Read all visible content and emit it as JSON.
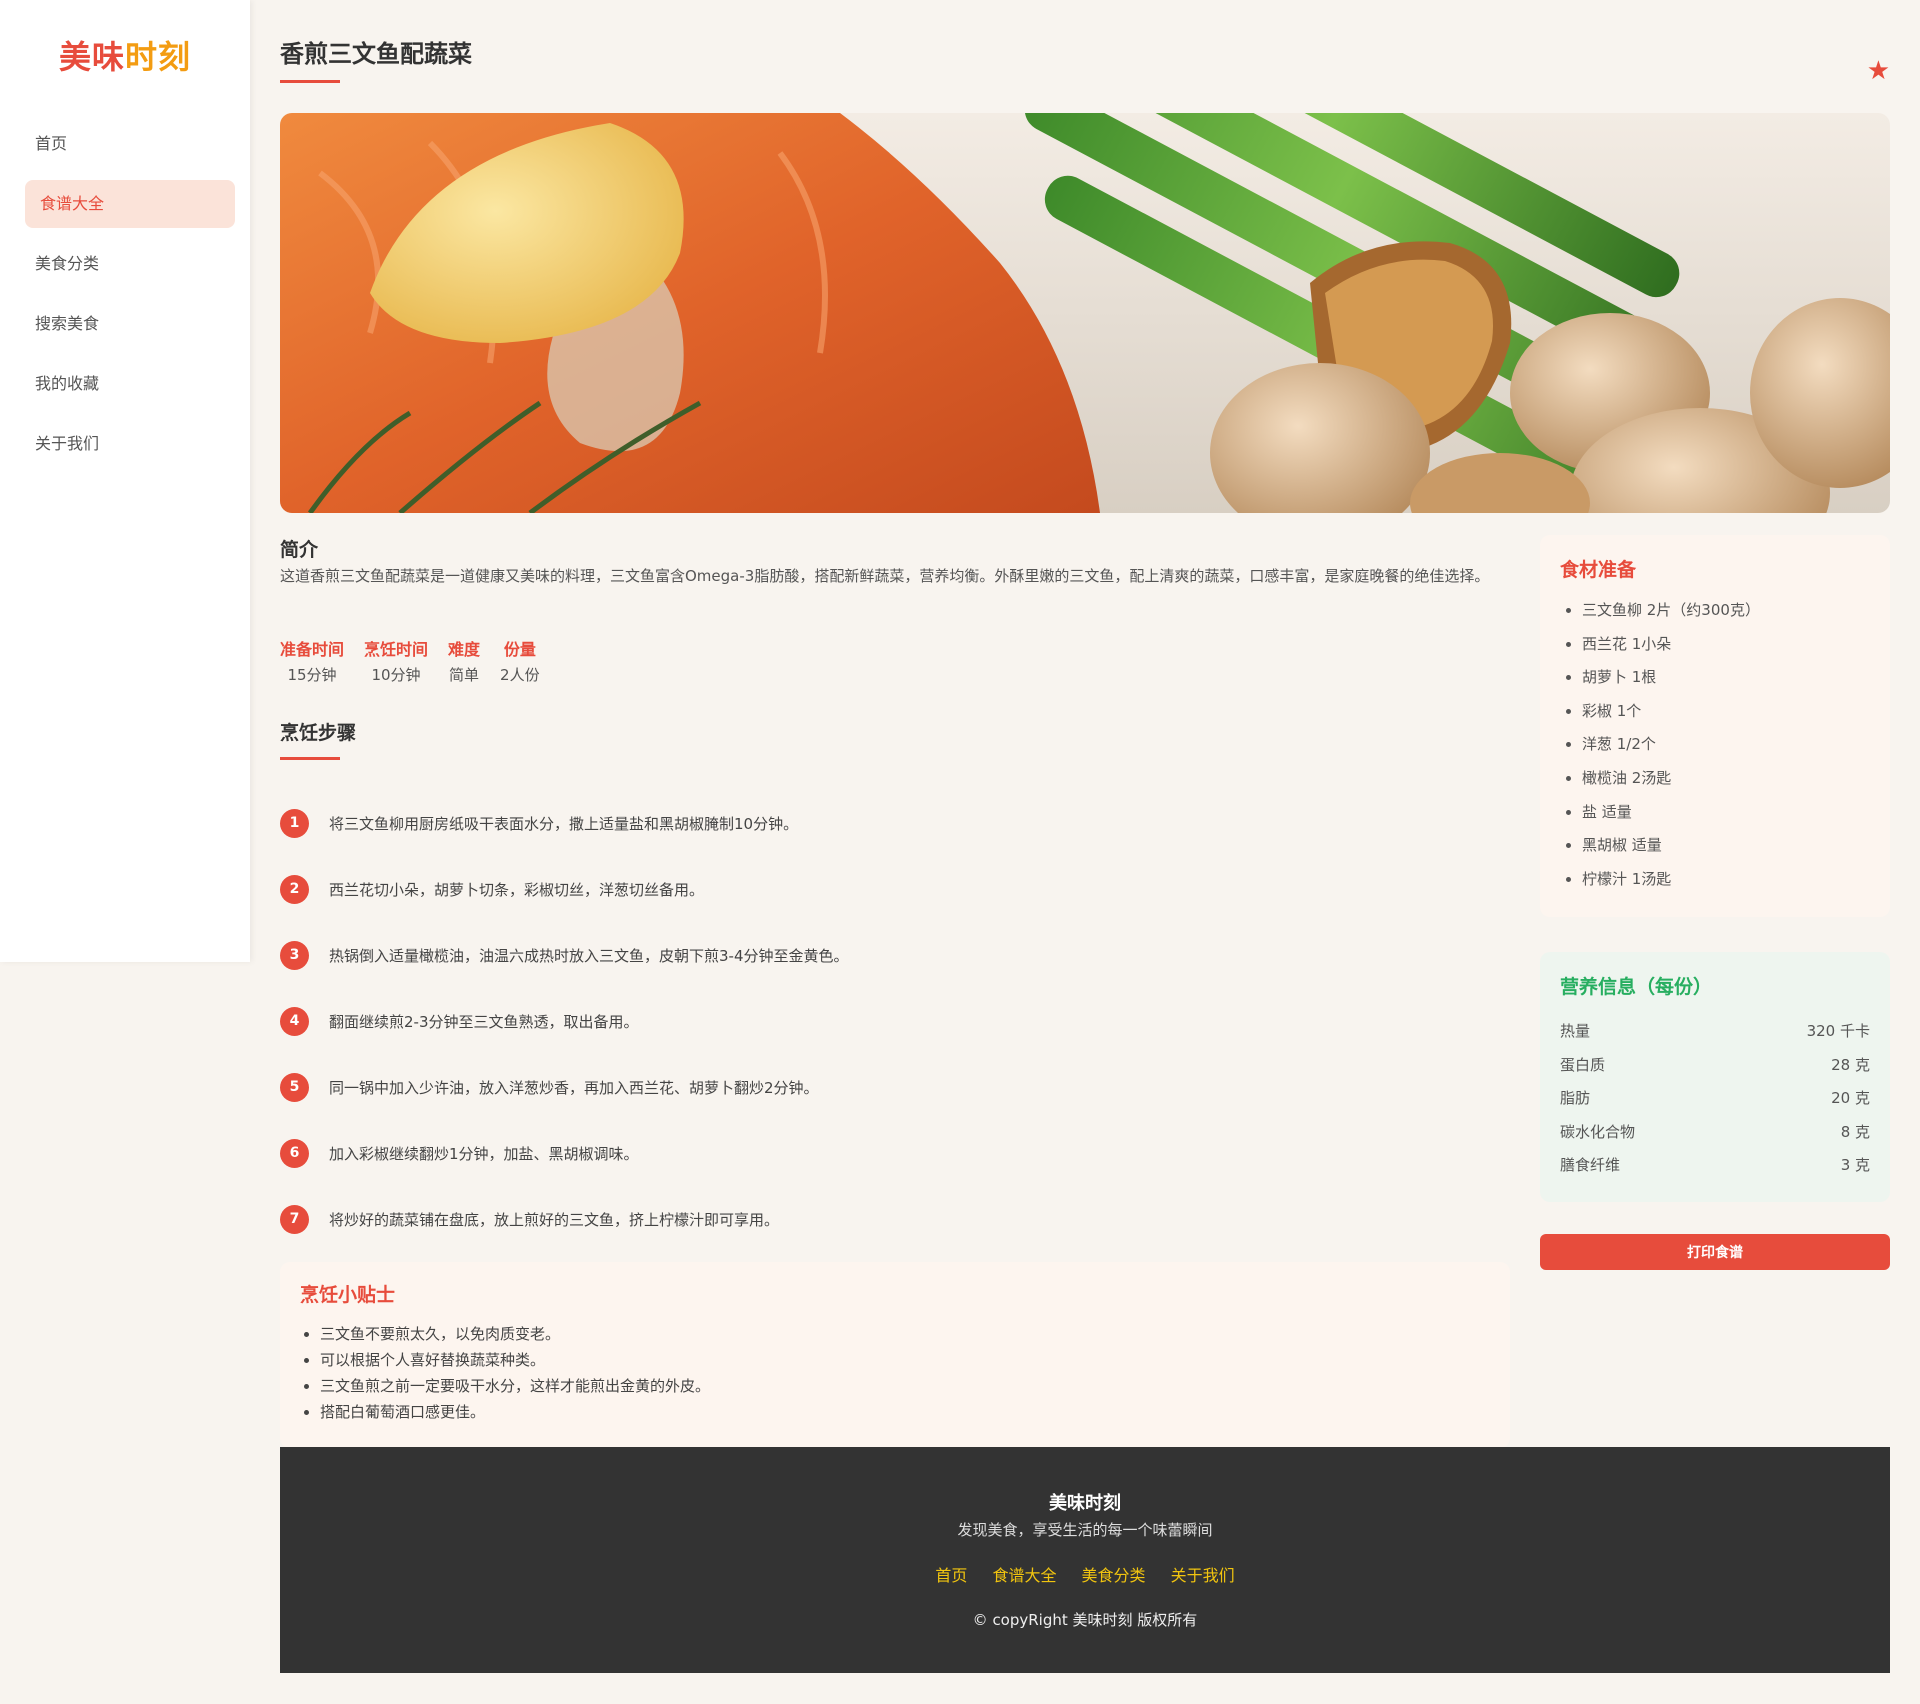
{
  "brand": {
    "part1": "美味",
    "part2": "时刻"
  },
  "nav": {
    "items": [
      {
        "label": "首页"
      },
      {
        "label": "食谱大全"
      },
      {
        "label": "美食分类"
      },
      {
        "label": "搜索美食"
      },
      {
        "label": "我的收藏"
      },
      {
        "label": "关于我们"
      }
    ]
  },
  "recipe": {
    "title": "香煎三文鱼配蔬菜",
    "favorite_icon": "★",
    "intro_heading": "简介",
    "intro_text": "这道香煎三文鱼配蔬菜是一道健康又美味的料理，三文鱼富含Omega-3脂肪酸，搭配新鲜蔬菜，营养均衡。外酥里嫩的三文鱼，配上清爽的蔬菜，口感丰富，是家庭晚餐的绝佳选择。",
    "meta": [
      {
        "label": "准备时间",
        "value": "15分钟"
      },
      {
        "label": "烹饪时间",
        "value": "10分钟"
      },
      {
        "label": "难度",
        "value": "简单"
      },
      {
        "label": "份量",
        "value": "2人份"
      }
    ],
    "steps_heading": "烹饪步骤",
    "steps": [
      {
        "num": "1",
        "text": "将三文鱼柳用厨房纸吸干表面水分，撒上适量盐和黑胡椒腌制10分钟。"
      },
      {
        "num": "2",
        "text": "西兰花切小朵，胡萝卜切条，彩椒切丝，洋葱切丝备用。"
      },
      {
        "num": "3",
        "text": "热锅倒入适量橄榄油，油温六成热时放入三文鱼，皮朝下煎3-4分钟至金黄色。"
      },
      {
        "num": "4",
        "text": "翻面继续煎2-3分钟至三文鱼熟透，取出备用。"
      },
      {
        "num": "5",
        "text": "同一锅中加入少许油，放入洋葱炒香，再加入西兰花、胡萝卜翻炒2分钟。"
      },
      {
        "num": "6",
        "text": "加入彩椒继续翻炒1分钟，加盐、黑胡椒调味。"
      },
      {
        "num": "7",
        "text": "将炒好的蔬菜铺在盘底，放上煎好的三文鱼，挤上柠檬汁即可享用。"
      }
    ],
    "tips_heading": "烹饪小贴士",
    "tips": [
      "三文鱼不要煎太久，以免肉质变老。",
      "可以根据个人喜好替换蔬菜种类。",
      "三文鱼煎之前一定要吸干水分，这样才能煎出金黄的外皮。",
      "搭配白葡萄酒口感更佳。"
    ],
    "ingredients_heading": "食材准备",
    "ingredients": [
      "三文鱼柳 2片（约300克）",
      "西兰花 1小朵",
      "胡萝卜 1根",
      "彩椒 1个",
      "洋葱 1/2个",
      "橄榄油 2汤匙",
      "盐 适量",
      "黑胡椒 适量",
      "柠檬汁 1汤匙"
    ],
    "nutrition_heading": "营养信息（每份）",
    "nutrition": [
      {
        "name": "热量",
        "value": "320 千卡"
      },
      {
        "name": "蛋白质",
        "value": "28 克"
      },
      {
        "name": "脂肪",
        "value": "20 克"
      },
      {
        "name": "碳水化合物",
        "value": "8 克"
      },
      {
        "name": "膳食纤维",
        "value": "3 克"
      }
    ],
    "print_label": "打印食谱"
  },
  "footer": {
    "brand": "美味时刻",
    "slogan": "发现美食，享受生活的每一个味蕾瞬间",
    "links": [
      "首页",
      "食谱大全",
      "美食分类",
      "关于我们"
    ],
    "copyright": "© copyRight 美味时刻 版权所有"
  },
  "colors": {
    "accent": "#e74c3c",
    "brand_secondary": "#f39c12",
    "nutrition_green": "#27ae60",
    "footer_link": "#f1c40f",
    "footer_bg": "#333333"
  },
  "icons": {
    "favorite": "star-icon"
  }
}
